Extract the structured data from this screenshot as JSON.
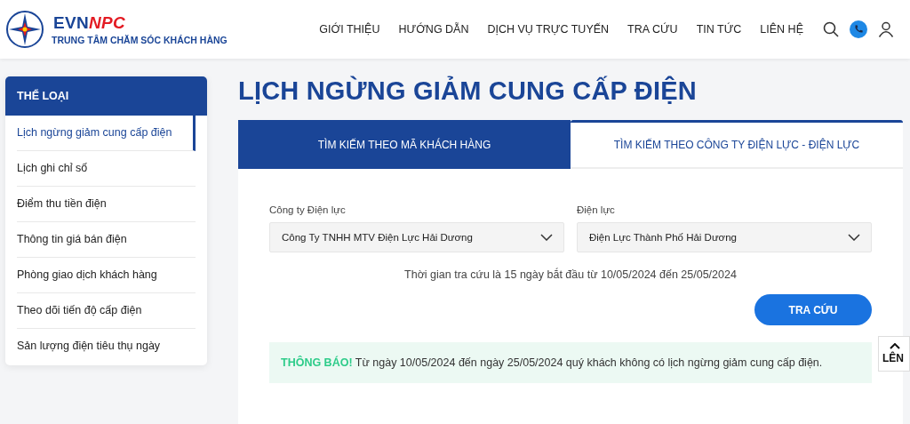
{
  "header": {
    "brand": {
      "part_1": "EVN",
      "part_2": "NPC",
      "tagline": "TRUNG TÂM CHĂM SÓC KHÁCH HÀNG"
    },
    "nav": [
      "GIỚI THIỆU",
      "HƯỚNG DẪN",
      "DỊCH VỤ TRỰC TUYẾN",
      "TRA CỨU",
      "TIN TỨC",
      "LIÊN HỆ"
    ]
  },
  "sidebar": {
    "title": "THỂ LOẠI",
    "items": [
      {
        "label": "Lịch ngừng giảm cung cấp điện",
        "selected": true
      },
      {
        "label": "Lịch ghi chỉ số",
        "selected": false
      },
      {
        "label": "Điểm thu tiền điện",
        "selected": false
      },
      {
        "label": "Thông tin giá bán điện",
        "selected": false
      },
      {
        "label": "Phòng giao dịch khách hàng",
        "selected": false
      },
      {
        "label": "Theo dõi tiến độ cấp điện",
        "selected": false
      },
      {
        "label": "Sản lượng điện tiêu thụ ngày",
        "selected": false
      }
    ]
  },
  "page_title": "LỊCH NGỪNG GIẢM CUNG CẤP ĐIỆN",
  "tabs": [
    {
      "label": "TÌM KIẾM THEO MÃ KHÁCH HÀNG",
      "selected": false
    },
    {
      "label": "TÌM KIẾM THEO CÔNG TY ĐIỆN LỰC - ĐIỆN LỰC",
      "selected": true
    }
  ],
  "fields": [
    {
      "label": "Công ty Điện lực",
      "value": "Công Ty TNHH MTV Điện Lực Hải Dương"
    },
    {
      "label": "Điện lực",
      "value": "Điện Lực Thành Phố Hải Dương"
    }
  ],
  "period_note": "Thời gian tra cứu là 15 ngày bắt đầu từ 10/05/2024 đến 25/05/2024",
  "search_button": "TRA CỨU",
  "notice": "**THÔNG BÁO!** Từ ngày 10/05/2024 đến ngày 25/05/2024 quý khách không có lịch ngừng giảm cung cấp điện.",
  "back_to_top": "LÊN"
}
